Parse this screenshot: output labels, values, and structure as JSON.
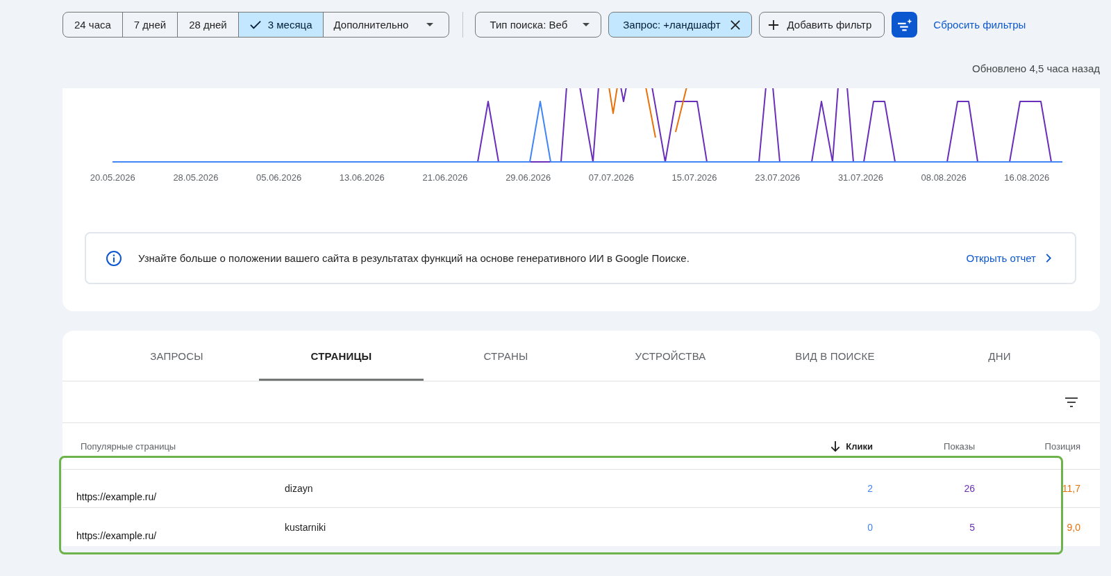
{
  "period_options": [
    {
      "label": "24 часа",
      "selected": false
    },
    {
      "label": "7 дней",
      "selected": false
    },
    {
      "label": "28 дней",
      "selected": false
    },
    {
      "label": "3 месяца",
      "selected": true
    }
  ],
  "more_dropdown": {
    "label": "Дополнительно"
  },
  "filters": [
    {
      "kind": "dropdown",
      "label": "Тип поиска: Веб",
      "active": false
    },
    {
      "kind": "removable",
      "label": "Запрос: +ландшафт",
      "active": true
    },
    {
      "kind": "add",
      "label": "Добавить фильтр",
      "active": false
    }
  ],
  "reset_link": "Сбросить фильтры",
  "updated": "Обновлено 4,5 часа назад",
  "chart": {
    "x_labels": [
      "20.05.2026",
      "28.05.2026",
      "05.06.2026",
      "13.06.2026",
      "21.06.2026",
      "29.06.2026",
      "07.07.2026",
      "15.07.2026",
      "23.07.2026",
      "31.07.2026",
      "08.08.2026",
      "16.08.2026"
    ]
  },
  "banner": {
    "text": "Узнайте больше о положении вашего сайта в результатах функций на основе генеративного ИИ в Google Поиске.",
    "link": "Открыть отчет"
  },
  "tabs": [
    {
      "label": "ЗАПРОСЫ",
      "selected": false
    },
    {
      "label": "СТРАНИЦЫ",
      "selected": true
    },
    {
      "label": "СТРАНЫ",
      "selected": false
    },
    {
      "label": "УСТРОЙСТВА",
      "selected": false
    },
    {
      "label": "ВИД В ПОИСКЕ",
      "selected": false
    },
    {
      "label": "ДНИ",
      "selected": false
    }
  ],
  "table": {
    "columns": [
      {
        "label": "Популярные страницы",
        "sorted": false
      },
      {
        "label": "Клики",
        "sorted": true,
        "color": "#4285f4"
      },
      {
        "label": "Показы",
        "sorted": false,
        "color": "#6a2fb8"
      },
      {
        "label": "Позиция",
        "sorted": false,
        "color": "#e8710a"
      }
    ],
    "rows": [
      {
        "page": {
          "overlay": "https://example.ru/",
          "tail": "dizayn"
        },
        "values": [
          "2",
          "26",
          "11,7"
        ]
      },
      {
        "page": {
          "overlay": "https://example.ru/",
          "tail": "kustarniki"
        },
        "values": [
          "0",
          "5",
          "9,0"
        ]
      }
    ]
  }
}
